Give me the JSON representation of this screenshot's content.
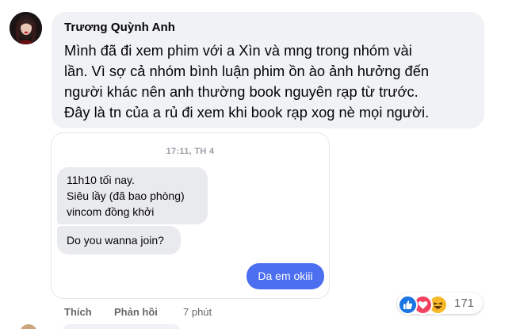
{
  "comment": {
    "author": "Trương Quỳnh Anh",
    "text_lines": [
      "Mình đã đi xem phim với a Xìn và mng trong nhóm vài",
      "lần. Vì sợ cả nhóm bình luận phim ồn ào ảnh hưởng đến",
      "người khác nên anh thường book nguyên rạp từ trước.",
      "Đây là tn của a rủ đi xem khi book rạp xog nè mọi người."
    ]
  },
  "screenshot": {
    "timestamp": "17:11, TH 4",
    "message1_lines": [
      "11h10 tối nay.",
      "Siêu lầy (đã bao phòng)",
      "vincom đồng khởi"
    ],
    "message2": "Do you wanna join?",
    "reply": "Da em okiii"
  },
  "actions": {
    "like_label": "Thích",
    "reply_label": "Phản hồi",
    "time": "7 phút"
  },
  "reactions": {
    "icons": [
      "like-icon",
      "love-icon",
      "haha-icon"
    ],
    "count": "171"
  },
  "colors": {
    "bubble_bg": "#f0f2f5",
    "outgoing_message": "#4c6ef0",
    "like": "#1b74e4",
    "love": "#f3425f",
    "haha": "#f7b928"
  }
}
